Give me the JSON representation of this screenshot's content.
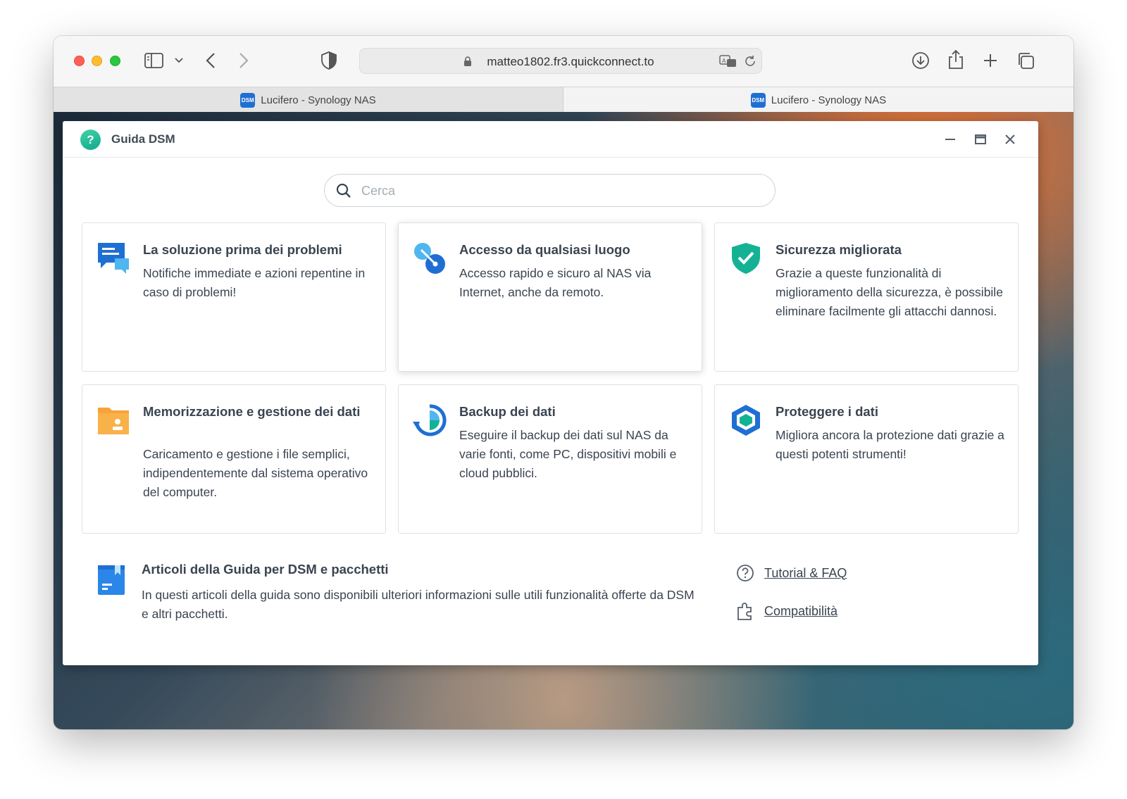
{
  "browser": {
    "url": "matteo1802.fr3.quickconnect.to",
    "tabs": [
      {
        "label": "Lucifero - Synology NAS",
        "favicon": "DSM"
      },
      {
        "label": "Lucifero - Synology NAS",
        "favicon": "DSM"
      }
    ]
  },
  "window": {
    "title": "Guida DSM",
    "app_icon": "help-question-icon"
  },
  "search": {
    "placeholder": "Cerca",
    "value": ""
  },
  "cards": [
    {
      "title": "La soluzione prima dei problemi",
      "description": "Notifiche immediate e azioni repentine in caso di problemi!",
      "icon": "chat-notification-icon"
    },
    {
      "title": "Accesso da qualsiasi luogo",
      "description": "Accesso rapido e sicuro al NAS via Internet, anche da remoto.",
      "icon": "remote-access-icon"
    },
    {
      "title": "Sicurezza migliorata",
      "description": "Grazie a queste funzionalità di miglioramento della sicurezza, è possibile eliminare facilmente gli attacchi dannosi.",
      "icon": "shield-check-icon"
    },
    {
      "title": "Memorizzazione e gestione dei dati",
      "description": "Caricamento e gestione i file semplici, indipendentemente dal sistema operativo del computer.",
      "icon": "folder-user-icon"
    },
    {
      "title": "Backup dei dati",
      "description": "Eseguire il backup dei dati sul NAS da varie fonti, come PC, dispositivi mobili e cloud pubblici.",
      "icon": "backup-icon"
    },
    {
      "title": "Proteggere i dati",
      "description": "Migliora ancora la protezione dati grazie a questi potenti strumenti!",
      "icon": "hexagon-shield-icon"
    }
  ],
  "articles": {
    "title": "Articoli della Guida per DSM e pacchetti",
    "description": "In questi articoli della guida sono disponibili ulteriori informazioni sulle utili funzionalità offerte da DSM e altri pacchetti.",
    "icon": "guide-book-icon"
  },
  "links": [
    {
      "label": "Tutorial & FAQ",
      "icon": "question-circle-icon"
    },
    {
      "label": "Compatibilità",
      "icon": "puzzle-icon"
    }
  ],
  "colors": {
    "accent_blue": "#1f6fd3",
    "teal": "#14b295",
    "orange": "#f7a23b",
    "text": "#3a4451"
  }
}
